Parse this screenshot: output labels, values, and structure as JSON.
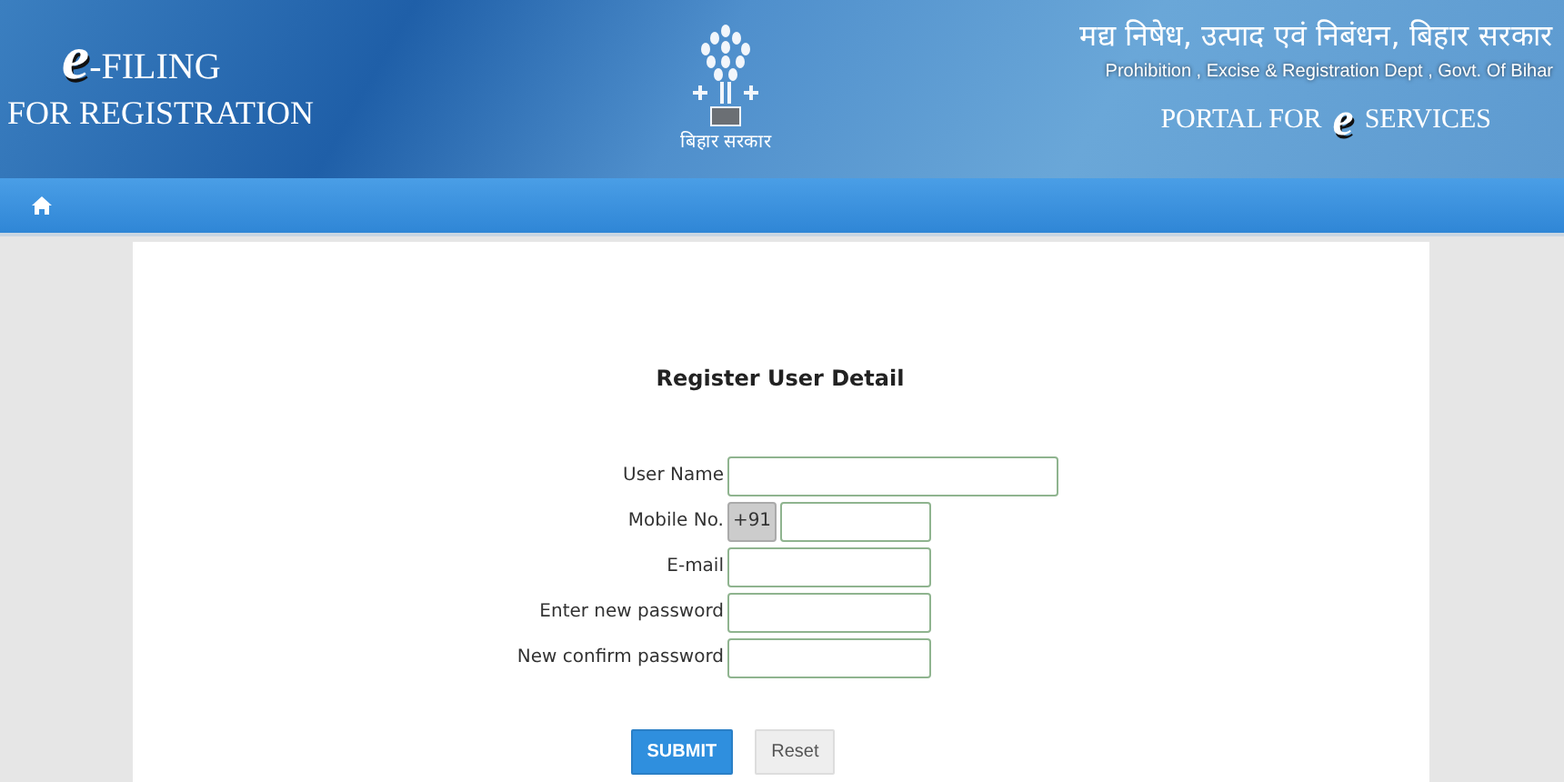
{
  "header": {
    "logo_e": "e",
    "logo_title": "-FILING",
    "logo_subtitle": "FOR REGISTRATION",
    "emblem_caption": "बिहार सरकार",
    "dept_hindi": "मद्य निषेध, उत्पाद एवं निबंधन, बिहार सरकार",
    "dept_english": "Prohibition , Excise & Registration Dept , Govt. Of Bihar",
    "portal_before": "PORTAL FOR",
    "portal_e": "e",
    "portal_after": "SERVICES"
  },
  "form": {
    "title": "Register User Detail",
    "fields": [
      {
        "label": "User Name",
        "kind": "wide"
      },
      {
        "label": "Mobile No.",
        "kind": "phone",
        "prefix": "+91"
      },
      {
        "label": "E-mail",
        "kind": "text"
      },
      {
        "label": "Enter new password",
        "kind": "text"
      },
      {
        "label": "New confirm password",
        "kind": "text"
      }
    ],
    "buttons": [
      {
        "label": "SUBMIT",
        "kind": "primary"
      },
      {
        "label": "Reset",
        "kind": "secondary"
      }
    ]
  }
}
